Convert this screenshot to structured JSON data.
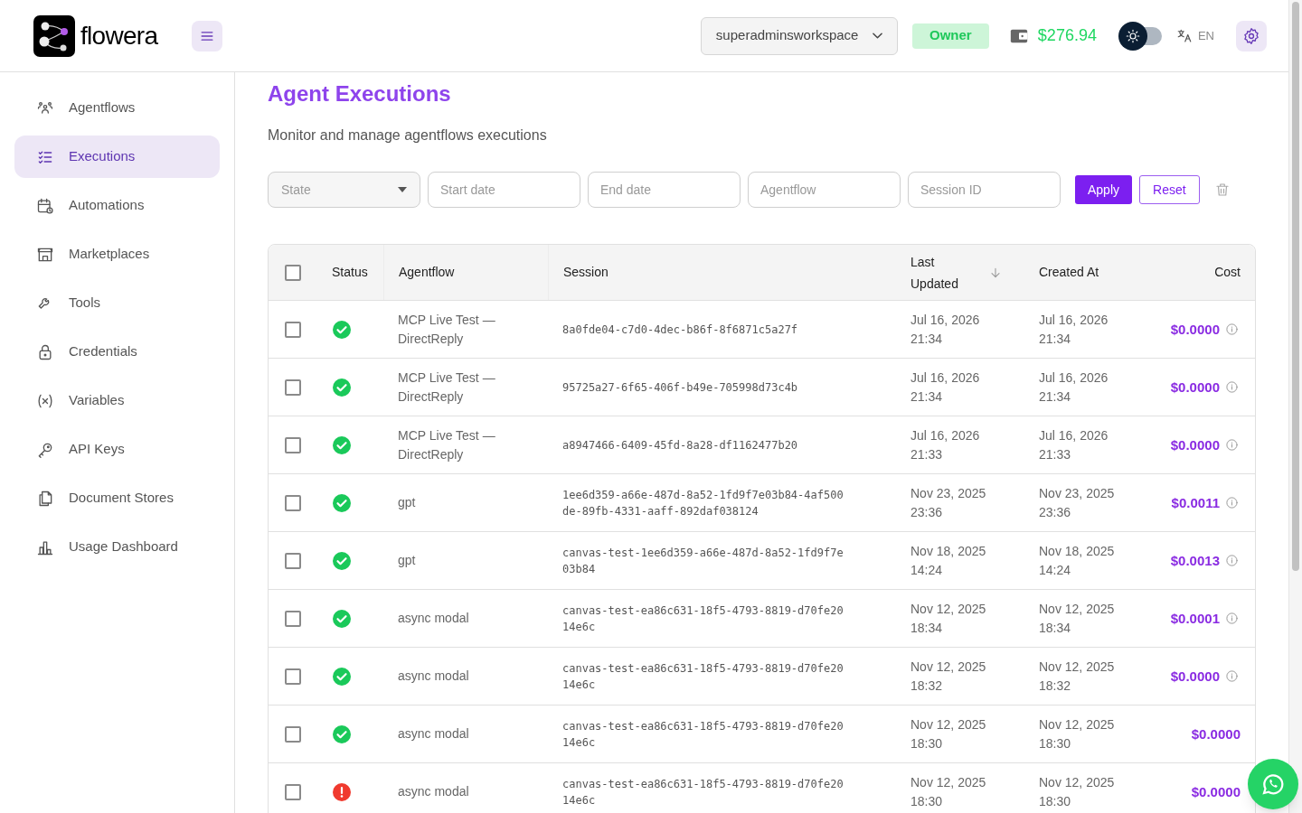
{
  "header": {
    "brand": "flowera",
    "workspace": "superadminsworkspace",
    "role": "Owner",
    "balance": "$276.94",
    "dark_mode": false,
    "language": "EN"
  },
  "sidebar": {
    "items": [
      {
        "label": "Agentflows",
        "selected": false
      },
      {
        "label": "Executions",
        "selected": true
      },
      {
        "label": "Automations",
        "selected": false
      },
      {
        "label": "Marketplaces",
        "selected": false
      },
      {
        "label": "Tools",
        "selected": false
      },
      {
        "label": "Credentials",
        "selected": false
      },
      {
        "label": "Variables",
        "selected": false
      },
      {
        "label": "API Keys",
        "selected": false
      },
      {
        "label": "Document Stores",
        "selected": false
      },
      {
        "label": "Usage Dashboard",
        "selected": false
      }
    ]
  },
  "page": {
    "title": "Agent Executions",
    "subtitle": "Monitor and manage agentflows executions"
  },
  "filters": {
    "state": {
      "placeholder": "State"
    },
    "start_date": {
      "placeholder": "Start date"
    },
    "end_date": {
      "placeholder": "End date"
    },
    "agentflow": {
      "placeholder": "Agentflow"
    },
    "session_id": {
      "placeholder": "Session ID"
    },
    "buttons": [
      "Apply",
      "Reset"
    ]
  },
  "table": {
    "select_all": false,
    "columns": [
      "Status",
      "Agentflow",
      "Session",
      "Last Updated",
      "Created At",
      "Cost"
    ],
    "rows": [
      {
        "checked": false,
        "kind": "success",
        "agentflow": "MCP Live Test — DirectReply",
        "session": "8a0fde04-c7d0-4dec-b86f-8f6871c5a27f",
        "updated": [
          "Jul 16, 2026",
          "21:34"
        ],
        "created": [
          "Jul 16, 2026",
          "21:34"
        ],
        "cost": "$0.0000",
        "info": true
      },
      {
        "checked": false,
        "kind": "success",
        "agentflow": "MCP Live Test — DirectReply",
        "session": "95725a27-6f65-406f-b49e-705998d73c4b",
        "updated": [
          "Jul 16, 2026",
          "21:34"
        ],
        "created": [
          "Jul 16, 2026",
          "21:34"
        ],
        "cost": "$0.0000",
        "info": true
      },
      {
        "checked": false,
        "kind": "success",
        "agentflow": "MCP Live Test — DirectReply",
        "session": "a8947466-6409-45fd-8a28-df1162477b20",
        "updated": [
          "Jul 16, 2026",
          "21:33"
        ],
        "created": [
          "Jul 16, 2026",
          "21:33"
        ],
        "cost": "$0.0000",
        "info": true
      },
      {
        "checked": false,
        "kind": "success",
        "agentflow": "gpt",
        "session": "1ee6d359-a66e-487d-8a52-1fd9f7e03b84-4af500de-89fb-4331-aaff-892daf038124",
        "updated": [
          "Nov 23, 2025",
          "23:36"
        ],
        "created": [
          "Nov 23, 2025",
          "23:36"
        ],
        "cost": "$0.0011",
        "info": true
      },
      {
        "checked": false,
        "kind": "success",
        "agentflow": "gpt",
        "session": "canvas-test-1ee6d359-a66e-487d-8a52-1fd9f7e03b84",
        "updated": [
          "Nov 18, 2025",
          "14:24"
        ],
        "created": [
          "Nov 18, 2025",
          "14:24"
        ],
        "cost": "$0.0013",
        "info": true
      },
      {
        "checked": false,
        "kind": "success",
        "agentflow": "async modal",
        "session": "canvas-test-ea86c631-18f5-4793-8819-d70fe2014e6c",
        "updated": [
          "Nov 12, 2025",
          "18:34"
        ],
        "created": [
          "Nov 12, 2025",
          "18:34"
        ],
        "cost": "$0.0001",
        "info": true
      },
      {
        "checked": false,
        "kind": "success",
        "agentflow": "async modal",
        "session": "canvas-test-ea86c631-18f5-4793-8819-d70fe2014e6c",
        "updated": [
          "Nov 12, 2025",
          "18:32"
        ],
        "created": [
          "Nov 12, 2025",
          "18:32"
        ],
        "cost": "$0.0000",
        "info": true
      },
      {
        "checked": false,
        "kind": "success",
        "agentflow": "async modal",
        "session": "canvas-test-ea86c631-18f5-4793-8819-d70fe2014e6c",
        "updated": [
          "Nov 12, 2025",
          "18:30"
        ],
        "created": [
          "Nov 12, 2025",
          "18:30"
        ],
        "cost": "$0.0000",
        "info": false
      },
      {
        "checked": false,
        "kind": "error",
        "agentflow": "async modal",
        "session": "canvas-test-ea86c631-18f5-4793-8819-d70fe2014e6c",
        "updated": [
          "Nov 12, 2025",
          "18:30"
        ],
        "created": [
          "Nov 12, 2025",
          "18:30"
        ],
        "cost": "$0.0000",
        "info": false
      }
    ]
  }
}
